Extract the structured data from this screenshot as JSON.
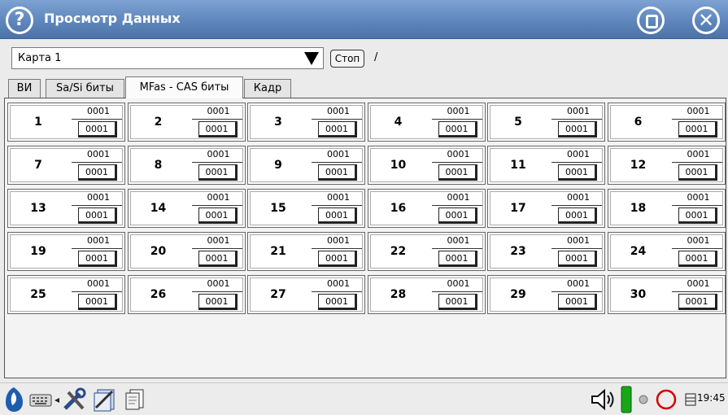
{
  "window": {
    "title": "Просмотр Данных"
  },
  "toolbar": {
    "source_value": "Карта 1",
    "stop_label": "Стоп",
    "status_text": "/"
  },
  "tabs": [
    {
      "label": "ВИ",
      "active": false
    },
    {
      "label": "Sa/Si биты",
      "active": false
    },
    {
      "label": "MFas - CAS биты",
      "active": true
    },
    {
      "label": "Кадр",
      "active": false
    }
  ],
  "channels": [
    {
      "n": "1",
      "tx": "0001",
      "rx": "0001"
    },
    {
      "n": "2",
      "tx": "0001",
      "rx": "0001"
    },
    {
      "n": "3",
      "tx": "0001",
      "rx": "0001"
    },
    {
      "n": "4",
      "tx": "0001",
      "rx": "0001"
    },
    {
      "n": "5",
      "tx": "0001",
      "rx": "0001"
    },
    {
      "n": "6",
      "tx": "0001",
      "rx": "0001"
    },
    {
      "n": "7",
      "tx": "0001",
      "rx": "0001"
    },
    {
      "n": "8",
      "tx": "0001",
      "rx": "0001"
    },
    {
      "n": "9",
      "tx": "0001",
      "rx": "0001"
    },
    {
      "n": "10",
      "tx": "0001",
      "rx": "0001"
    },
    {
      "n": "11",
      "tx": "0001",
      "rx": "0001"
    },
    {
      "n": "12",
      "tx": "0001",
      "rx": "0001"
    },
    {
      "n": "13",
      "tx": "0001",
      "rx": "0001"
    },
    {
      "n": "14",
      "tx": "0001",
      "rx": "0001"
    },
    {
      "n": "15",
      "tx": "0001",
      "rx": "0001"
    },
    {
      "n": "16",
      "tx": "0001",
      "rx": "0001"
    },
    {
      "n": "17",
      "tx": "0001",
      "rx": "0001"
    },
    {
      "n": "18",
      "tx": "0001",
      "rx": "0001"
    },
    {
      "n": "19",
      "tx": "0001",
      "rx": "0001"
    },
    {
      "n": "20",
      "tx": "0001",
      "rx": "0001"
    },
    {
      "n": "21",
      "tx": "0001",
      "rx": "0001"
    },
    {
      "n": "22",
      "tx": "0001",
      "rx": "0001"
    },
    {
      "n": "23",
      "tx": "0001",
      "rx": "0001"
    },
    {
      "n": "24",
      "tx": "0001",
      "rx": "0001"
    },
    {
      "n": "25",
      "tx": "0001",
      "rx": "0001"
    },
    {
      "n": "26",
      "tx": "0001",
      "rx": "0001"
    },
    {
      "n": "27",
      "tx": "0001",
      "rx": "0001"
    },
    {
      "n": "28",
      "tx": "0001",
      "rx": "0001"
    },
    {
      "n": "29",
      "tx": "0001",
      "rx": "0001"
    },
    {
      "n": "30",
      "tx": "0001",
      "rx": "0001"
    }
  ],
  "taskbar": {
    "clock": "19:45",
    "icons": [
      "start-icon",
      "keyboard-icon",
      "arrow-icon",
      "tools-icon",
      "files-icon",
      "documents-icon",
      "speaker-icon",
      "battery-icon",
      "led-icon",
      "record-icon",
      "menu-icon"
    ]
  },
  "colors": {
    "titlebar": "#5f87bd",
    "battery": "#19a619",
    "record": "#d40000"
  }
}
